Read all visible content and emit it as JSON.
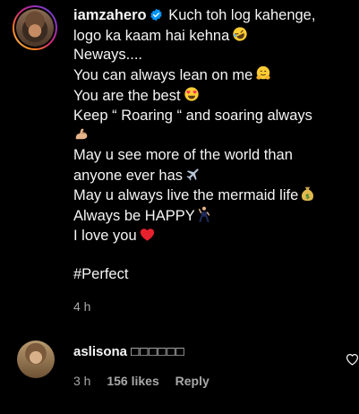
{
  "comment": {
    "username": "iamzahero",
    "verified": true,
    "lines": [
      {
        "text": "Kuch toh log kahenge,",
        "emoji": ""
      },
      {
        "text": "logo ka kaam hai kehna",
        "emoji": "rofl-emoji"
      },
      {
        "text": "Neways....",
        "emoji": ""
      },
      {
        "text": "You can always lean on me",
        "emoji": "hugging-face-emoji"
      },
      {
        "text": "You are the best",
        "emoji": "heart-eyes-emoji"
      },
      {
        "text": "Keep “ Roaring “ and soaring always",
        "emoji": ""
      },
      {
        "text": "",
        "emoji": "flexed-biceps-emoji"
      },
      {
        "text": "May u see more of the world than",
        "emoji": ""
      },
      {
        "text": "anyone ever has",
        "emoji": "airplane-emoji"
      },
      {
        "text": "May u always live the mermaid life",
        "emoji": "money-bag-emoji"
      },
      {
        "text": "Always be HAPPY",
        "emoji": "dancing-man-emoji"
      },
      {
        "text": "I love you",
        "emoji": "red-heart-emoji"
      }
    ],
    "hashtag": "#Perfect",
    "time": "4 h"
  },
  "reply": {
    "username": "aslisona",
    "text": "□□□□□□",
    "time": "3 h",
    "likes": "156 likes",
    "reply_label": "Reply",
    "like_icon": "heart-outline-icon"
  },
  "colors": {
    "background": "#000000",
    "text": "#f5f5f5",
    "secondary": "#a8a8a8",
    "verified": "#0095f6",
    "heart": "#ff3040"
  }
}
